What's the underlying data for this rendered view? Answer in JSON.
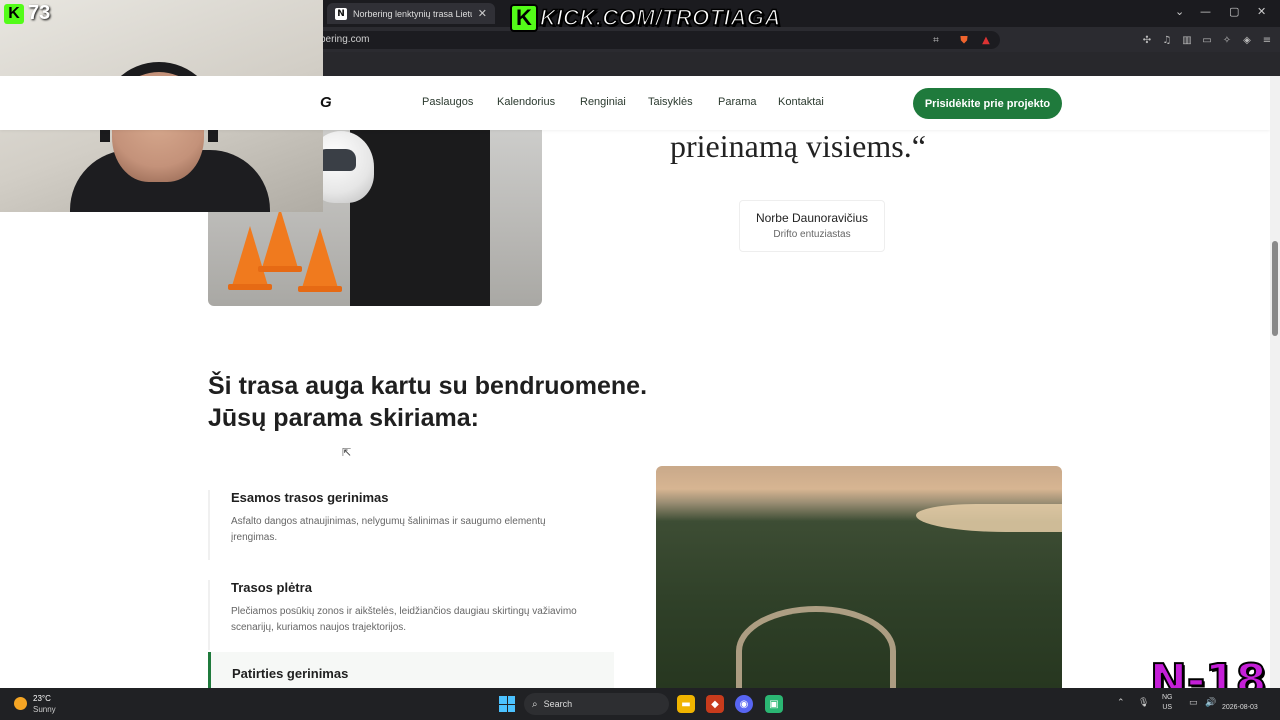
{
  "browser": {
    "tab_title": "Norbering lenktynių trasa Lietuv",
    "tab_favicon": "N",
    "url": "bering.com"
  },
  "overlay": {
    "kick_logo_letter": "K",
    "viewer_count": "73",
    "kick_banner": "KICK.COM/TROTIAGA",
    "rating_badge": "N-18"
  },
  "nav": {
    "logo_fragment": "G",
    "items": [
      "Paslaugos",
      "Kalendorius",
      "Renginiai",
      "Taisyklės",
      "Parama",
      "Kontaktai"
    ],
    "cta": "Prisidėkite prie projekto"
  },
  "quote": {
    "text": "prieinamą visiems.“",
    "author": "Norbe Daunoravičius",
    "role": "Drifto entuziastas"
  },
  "support": {
    "title": "Ši trasa auga kartu su bendruomene. Jūsų parama skiriama:",
    "items": [
      {
        "title": "Esamos trasos gerinimas",
        "desc": "Asfalto dangos atnaujinimas, nelygumų šalinimas ir saugumo elementų įrengimas."
      },
      {
        "title": "Trasos plėtra",
        "desc": "Plečiamos posūkių zonos ir aikštelės, leidžiančios daugiau skirtingų važiavimo scenarijų, kuriamos naujos trajektorijos."
      },
      {
        "title": "Patirties gerinimas",
        "desc": ""
      }
    ]
  },
  "taskbar": {
    "temperature": "23°C",
    "condition": "Sunny",
    "search_label": "Search",
    "lang_top": "NG",
    "lang_bottom": "US",
    "date": "2026-08-03"
  },
  "colors": {
    "accent": "#1f7a3c",
    "kick_green": "#53fc18",
    "badge_purple": "#c51fd8"
  }
}
